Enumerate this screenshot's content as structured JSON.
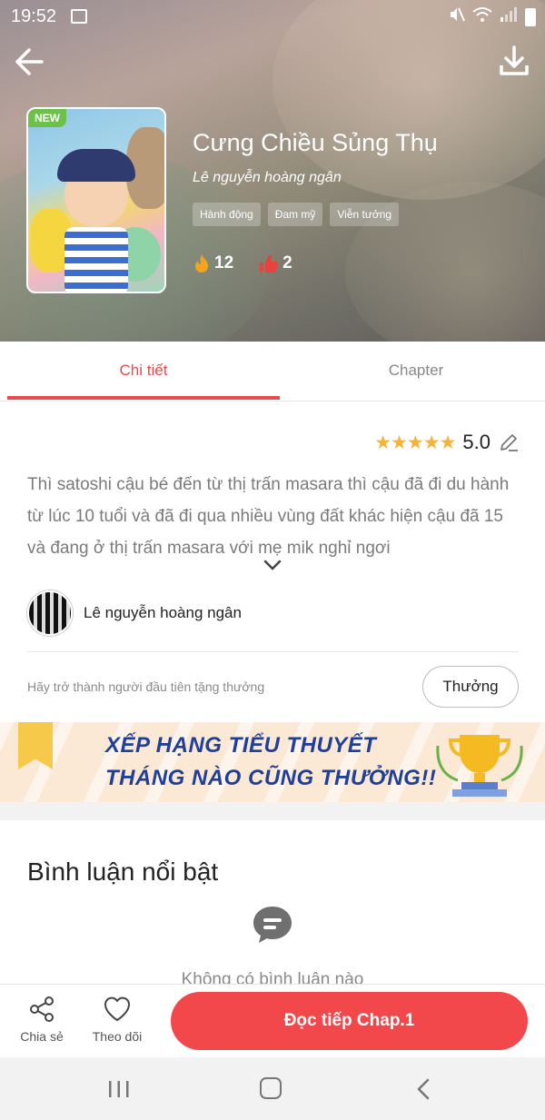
{
  "status_bar": {
    "time": "19:52"
  },
  "book": {
    "badge": "NEW",
    "title": "Cưng Chiều Sủng Thụ",
    "author": "Lê nguyễn hoàng ngân",
    "tags": [
      "Hành động",
      "Đam mỹ",
      "Viễn tưởng"
    ],
    "hot_count": "12",
    "like_count": "2"
  },
  "tabs": {
    "detail": "Chi tiết",
    "chapter": "Chapter"
  },
  "rating": {
    "stars": "★★★★★",
    "value": "5.0"
  },
  "synopsis": "Thì satoshi cậu bé đến từ thị trấn masara thì cậu đã đi du hành từ lúc 10 tuổi và đã đi qua nhiều vùng đất khác hiện cậu đã 15 và đang ở thị trấn masara với mẹ mik nghỉ ngơi",
  "author_row": {
    "name": "Lê nguyễn hoàng ngân"
  },
  "reward": {
    "prompt": "Hãy trở thành người đầu tiên tặng thưởng",
    "button": "Thưởng"
  },
  "banner": {
    "line1": "XẾP HẠNG TIỂU THUYẾT",
    "line2": "THÁNG NÀO CŨNG THƯỞNG!!"
  },
  "comments": {
    "title": "Bình luận nổi bật",
    "empty": "Không có bình luận nào"
  },
  "actions": {
    "share": "Chia sẻ",
    "follow": "Theo dõi",
    "read": "Đọc tiếp Chap.1"
  },
  "colors": {
    "accent": "#f2474b",
    "tab_active": "#e84b4b",
    "star": "#f4b33a",
    "banner_text": "#1f3f9a"
  }
}
